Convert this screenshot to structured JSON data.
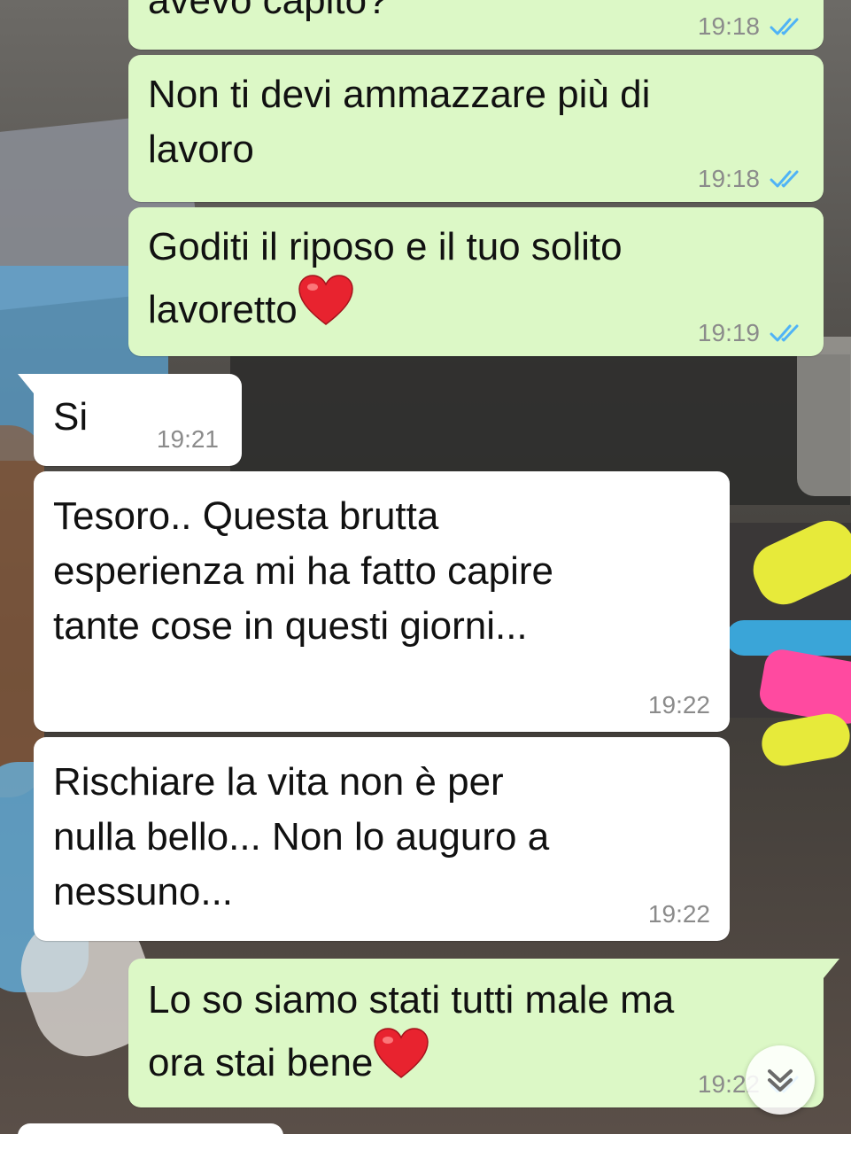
{
  "messages": [
    {
      "id": "m1",
      "direction": "sent",
      "text": "avevo capito?",
      "time": "19:18",
      "status": "read"
    },
    {
      "id": "m2",
      "direction": "sent",
      "text": "Non ti devi ammazzare più di\nlavoro",
      "time": "19:18",
      "status": "read"
    },
    {
      "id": "m3",
      "direction": "sent",
      "text": "Goditi il riposo e il tuo solito\nlavoretto",
      "emoji": "red-heart",
      "time": "19:19",
      "status": "read"
    },
    {
      "id": "m4",
      "direction": "received",
      "text": "Si",
      "time": "19:21"
    },
    {
      "id": "m5",
      "direction": "received",
      "text": "Tesoro.. Questa brutta\nesperienza mi ha fatto capire\ntante cose in questi giorni...",
      "time": "19:22"
    },
    {
      "id": "m6",
      "direction": "received",
      "text": "Rischiare la vita non è per\nnulla bello... Non lo auguro a\nnessuno...",
      "time": "19:22"
    },
    {
      "id": "m7",
      "direction": "sent",
      "text": "Lo so siamo stati tutti male ma\nora stai bene",
      "emoji": "red-heart",
      "time": "19:22",
      "status": "read"
    }
  ],
  "colors": {
    "sent_bubble": "#dcf8c6",
    "received_bubble": "#ffffff",
    "read_ticks": "#4fb3f6",
    "timestamp": "#8b8b8b"
  },
  "icons": {
    "read_receipt": "double-check-icon",
    "emoji": "red-heart-icon",
    "scroll_down": "chevron-double-down-icon"
  }
}
